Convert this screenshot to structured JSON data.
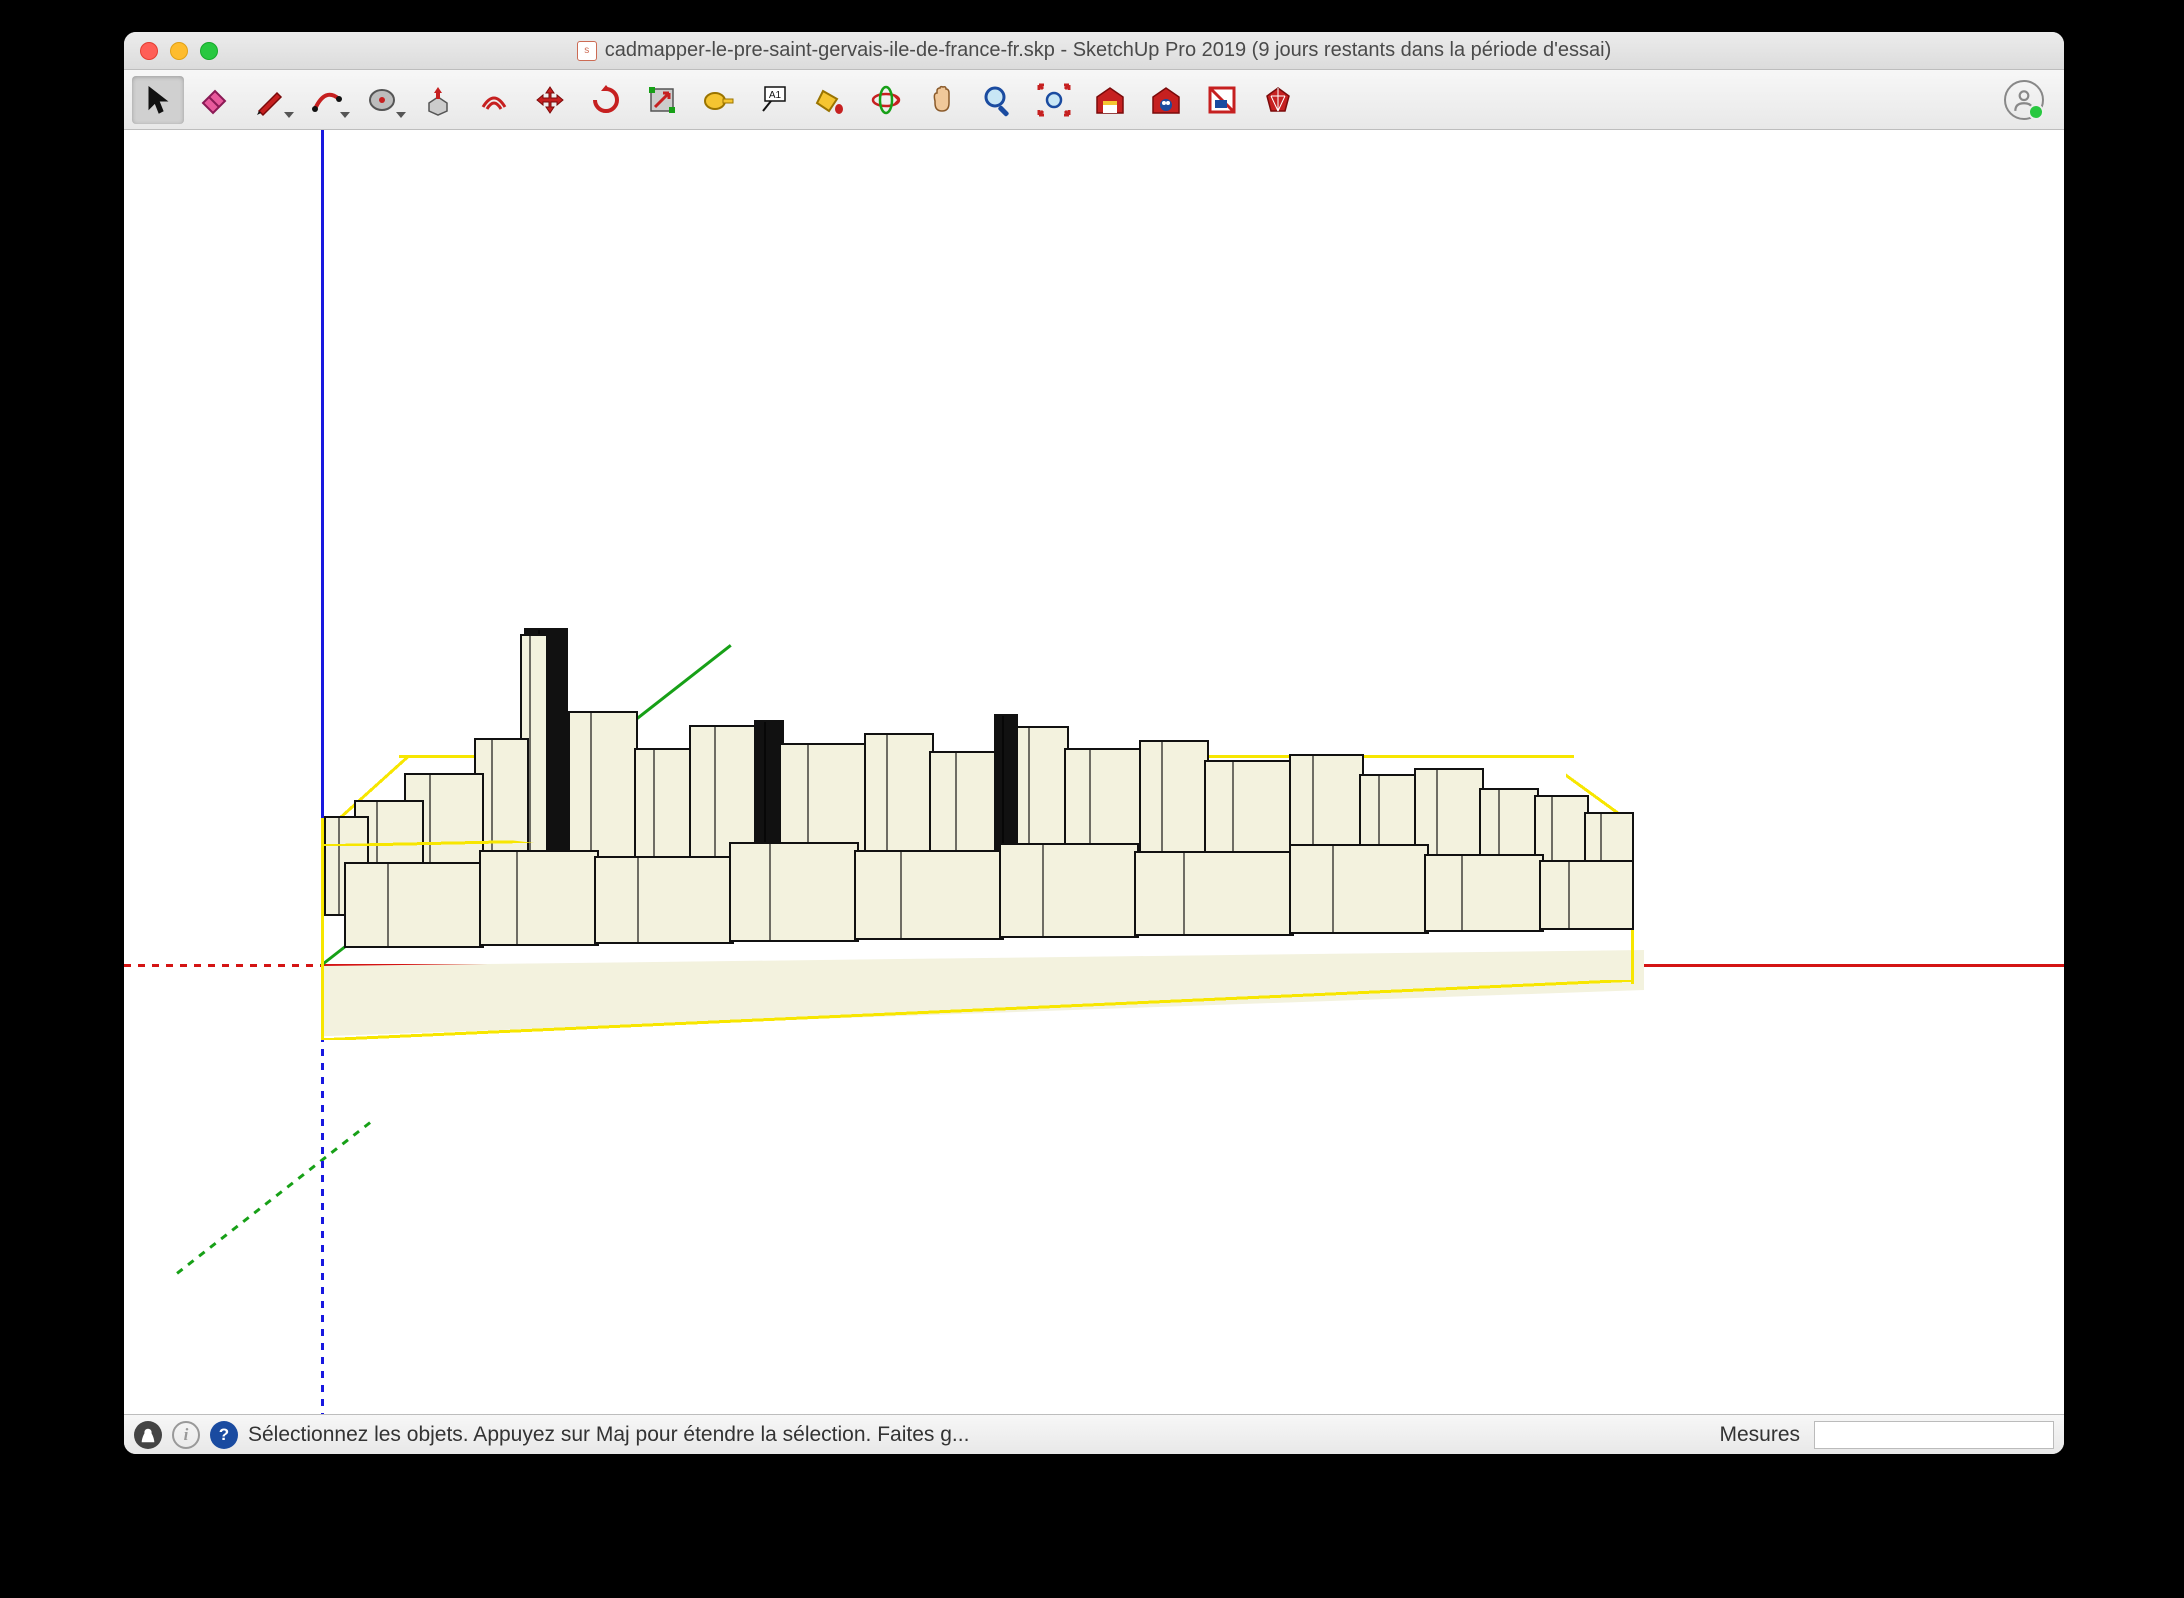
{
  "window": {
    "title": "cadmapper-le-pre-saint-gervais-ile-de-france-fr.skp - SketchUp Pro 2019 (9 jours restants dans la période d'essai)",
    "file_icon_label": "skp"
  },
  "toolbar": {
    "tools": [
      {
        "name": "select-tool",
        "dropdown": false,
        "active": true
      },
      {
        "name": "eraser-tool",
        "dropdown": false
      },
      {
        "name": "draw-tool",
        "dropdown": true
      },
      {
        "name": "arc-tool",
        "dropdown": true
      },
      {
        "name": "shape-tool",
        "dropdown": true
      },
      {
        "name": "pushpull-tool",
        "dropdown": false
      },
      {
        "name": "offset-tool",
        "dropdown": false
      },
      {
        "name": "move-tool",
        "dropdown": false
      },
      {
        "name": "rotate-tool",
        "dropdown": false
      },
      {
        "name": "scale-tool",
        "dropdown": false
      },
      {
        "name": "tape-measure-tool",
        "dropdown": false
      },
      {
        "name": "text-tool",
        "dropdown": false
      },
      {
        "name": "paint-bucket-tool",
        "dropdown": false
      },
      {
        "name": "orbit-tool",
        "dropdown": false
      },
      {
        "name": "pan-tool",
        "dropdown": false
      },
      {
        "name": "zoom-tool",
        "dropdown": false
      },
      {
        "name": "zoom-extents-tool",
        "dropdown": false
      },
      {
        "name": "warehouse-tool",
        "dropdown": false
      },
      {
        "name": "extension-warehouse-tool",
        "dropdown": false
      },
      {
        "name": "layout-tool",
        "dropdown": false
      },
      {
        "name": "ruby-tool",
        "dropdown": false
      }
    ]
  },
  "status": {
    "hint": "Sélectionnez les objets. Appuyez sur Maj pour étendre la sélection. Faites g...",
    "measures_label": "Mesures",
    "measures_value": ""
  }
}
